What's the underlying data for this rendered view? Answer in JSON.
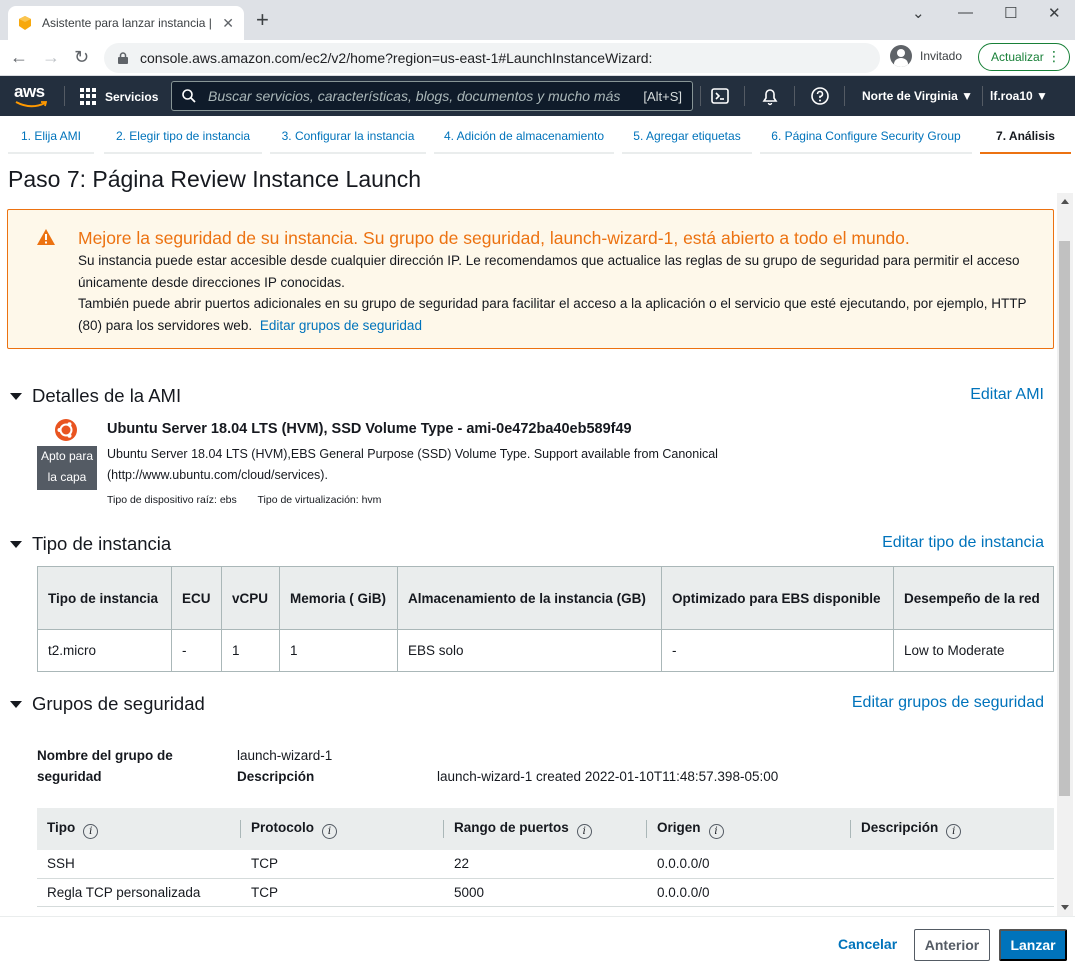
{
  "browser": {
    "tab_title": "Asistente para lanzar instancia | E",
    "tab_close": "✕",
    "new_tab": "+",
    "url": "console.aws.amazon.com/ec2/v2/home?region=us-east-1#LaunchInstanceWizard:",
    "guest_label": "Invitado",
    "update_label": "Actualizar",
    "update_menu": "⋮",
    "back": "←",
    "forward": "→",
    "reload": "↻",
    "win_min": "⌄",
    "win_minimize": "—",
    "win_max": "☐",
    "win_close": "✕"
  },
  "awsnav": {
    "logo": "aws",
    "services": "Servicios",
    "search_placeholder": "Buscar servicios, características, blogs, documentos y mucho más",
    "search_shortcut": "[Alt+S]",
    "region": "Norte de Virginia ▼",
    "user": "lf.roa10 ▼"
  },
  "steps": [
    {
      "label": "1. Elija AMI"
    },
    {
      "label": "2. Elegir tipo de instancia"
    },
    {
      "label": "3. Configurar la instancia"
    },
    {
      "label": "4. Adición de almacenamiento"
    },
    {
      "label": "5. Agregar etiquetas"
    },
    {
      "label": "6. Página Configure Security Group"
    },
    {
      "label": "7. Análisis"
    }
  ],
  "page_title": "Paso 7: Página Review Instance Launch",
  "alert": {
    "heading": "Mejore la seguridad de su instancia. Su grupo de seguridad, launch-wizard-1, está abierto a todo el mundo.",
    "line1": "Su instancia puede estar accesible desde cualquier dirección IP. Le recomendamos que actualice las reglas de su grupo de seguridad para permitir el acceso únicamente desde direcciones IP conocidas.",
    "line2": "También puede abrir puertos adicionales en su grupo de seguridad para facilitar el acceso a la aplicación o el servicio que esté ejecutando, por ejemplo, HTTP (80) para los servidores web.",
    "link": "Editar grupos de seguridad"
  },
  "ami": {
    "section": "Detalles de la AMI",
    "edit": "Editar AMI",
    "badge": "Apto para la capa",
    "name": "Ubuntu Server 18.04 LTS (HVM), SSD Volume Type - ami-0e472ba40eb589f49",
    "desc": "Ubuntu Server 18.04 LTS (HVM),EBS General Purpose (SSD) Volume Type. Support available from Canonical (http://www.ubuntu.com/cloud/services).",
    "root_device": "Tipo de dispositivo raíz: ebs",
    "virt": "Tipo de virtualización: hvm"
  },
  "instance": {
    "section": "Tipo de instancia",
    "edit": "Editar tipo de instancia",
    "headers": [
      "Tipo de instancia",
      "ECU",
      "vCPU",
      "Memoria ( GiB)",
      "Almacenamiento de la instancia (GB)",
      "Optimizado para EBS disponible",
      "Desempeño de la red"
    ],
    "row": [
      "t2.micro",
      "-",
      "1",
      "1",
      "EBS solo",
      "-",
      "Low to Moderate"
    ]
  },
  "security": {
    "section": "Grupos de seguridad",
    "edit": "Editar grupos de seguridad",
    "name_label": "Nombre del grupo de seguridad",
    "name_value": "launch-wizard-1",
    "desc_label": "Descripción",
    "desc_value": "launch-wizard-1 created 2022-01-10T11:48:57.398-05:00",
    "headers": [
      "Tipo",
      "Protocolo",
      "Rango de puertos",
      "Origen",
      "Descripción"
    ],
    "info": "i",
    "rows": [
      [
        "SSH",
        "TCP",
        "22",
        "0.0.0.0/0",
        ""
      ],
      [
        "Regla TCP personalizada",
        "TCP",
        "5000",
        "0.0.0.0/0",
        ""
      ]
    ]
  },
  "footer": {
    "cancel": "Cancelar",
    "previous": "Anterior",
    "launch": "Lanzar"
  },
  "colors": {
    "aws_nav": "#232f3e",
    "accent_orange": "#ec7211",
    "link_blue": "#0073bb",
    "alert_bg": "#fef8ea"
  }
}
